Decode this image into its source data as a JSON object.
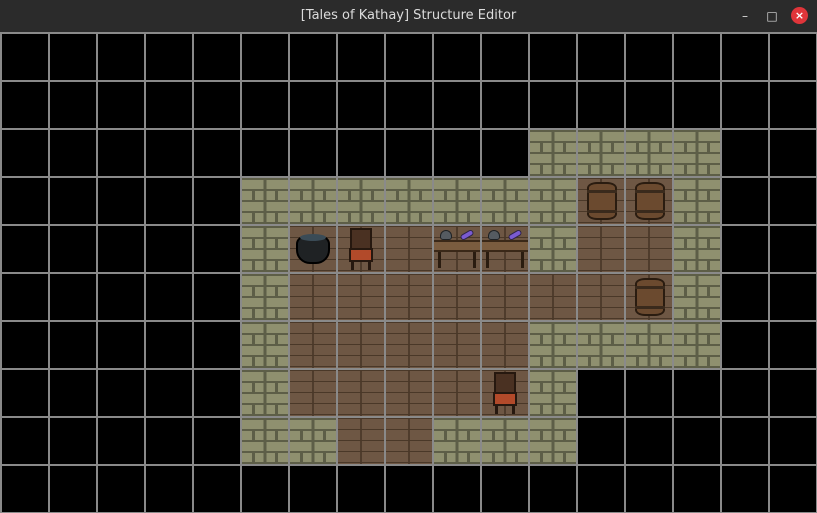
{
  "window": {
    "title": "[Tales of Kathay] Structure Editor",
    "controls": {
      "minimize": "–",
      "maximize": "□",
      "close": "×"
    }
  },
  "map": {
    "columns": 17,
    "rows": 10,
    "tiles": [
      "empty",
      "empty",
      "empty",
      "empty",
      "empty",
      "empty",
      "empty",
      "empty",
      "empty",
      "empty",
      "empty",
      "empty",
      "empty",
      "empty",
      "empty",
      "empty",
      "empty",
      "empty",
      "empty",
      "empty",
      "empty",
      "empty",
      "empty",
      "empty",
      "empty",
      "empty",
      "empty",
      "empty",
      "empty",
      "empty",
      "empty",
      "empty",
      "empty",
      "empty",
      "empty",
      "empty",
      "empty",
      "empty",
      "empty",
      "empty",
      "empty",
      "empty",
      "empty",
      "empty",
      "empty",
      "wall",
      "wall",
      "wall",
      "wall",
      "empty",
      "empty",
      "empty",
      "empty",
      "empty",
      "empty",
      "empty",
      "wall",
      "wall",
      "wall",
      "wall",
      "wall",
      "wall",
      "wall",
      "barrel",
      "barrel",
      "wall",
      "empty",
      "empty",
      "empty",
      "empty",
      "empty",
      "empty",
      "empty",
      "wall",
      "pot",
      "chair",
      "floor",
      "table",
      "table",
      "wall",
      "floor",
      "floor",
      "wall",
      "empty",
      "empty",
      "empty",
      "empty",
      "empty",
      "empty",
      "empty",
      "wall",
      "floor",
      "floor",
      "floor",
      "floor",
      "floor",
      "floor",
      "floor",
      "barrel",
      "wall",
      "empty",
      "empty",
      "empty",
      "empty",
      "empty",
      "empty",
      "empty",
      "wall",
      "floor",
      "floor",
      "floor",
      "floor",
      "floor",
      "wall",
      "wall",
      "wall",
      "wall",
      "empty",
      "empty",
      "empty",
      "empty",
      "empty",
      "empty",
      "empty",
      "wall",
      "floor",
      "floor",
      "floor",
      "floor",
      "chair",
      "wall",
      "empty",
      "empty",
      "empty",
      "empty",
      "empty",
      "empty",
      "empty",
      "empty",
      "empty",
      "empty",
      "wall",
      "wall",
      "floor",
      "floor",
      "wall",
      "wall",
      "wall",
      "empty",
      "empty",
      "empty",
      "empty",
      "empty",
      "empty",
      "empty",
      "empty",
      "empty",
      "empty",
      "empty",
      "empty",
      "empty",
      "empty",
      "empty",
      "empty",
      "empty",
      "empty",
      "empty",
      "empty",
      "empty",
      "empty"
    ],
    "colors": {
      "empty": "#000000",
      "grid_line": "#8a8a8a",
      "wall": "#8f906f",
      "floor": "#6e5744"
    }
  }
}
